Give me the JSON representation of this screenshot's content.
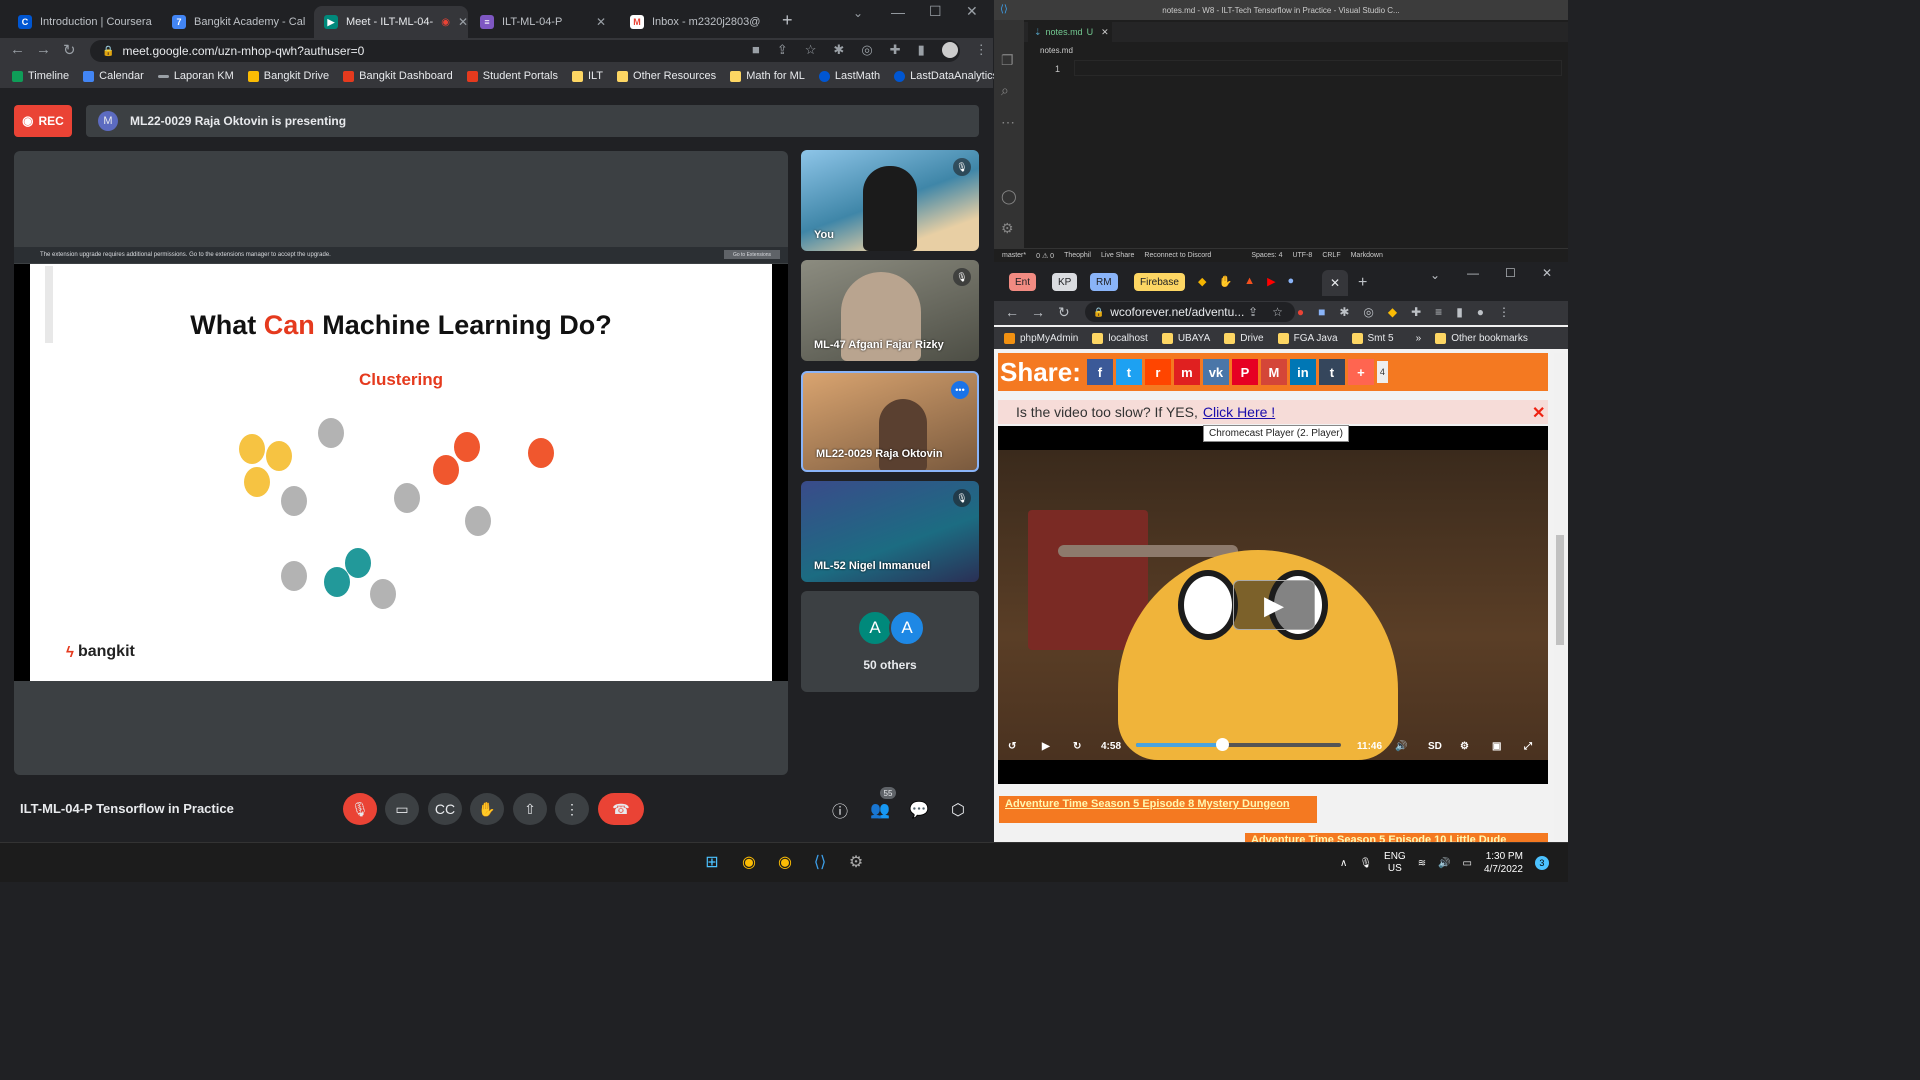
{
  "left_browser": {
    "tabs": [
      {
        "label": "Introduction | Coursera",
        "icon": "coursera-icon",
        "color": "#0056d2"
      },
      {
        "label": "Bangkit Academy - Cal",
        "icon": "calendar-icon",
        "color": "#4285f4"
      },
      {
        "label": "Meet - ILT-ML-04-",
        "icon": "meet-icon",
        "color": "#00897b"
      },
      {
        "label": "ILT-ML-04-P",
        "icon": "doc-icon",
        "color": "#7e57c2"
      },
      {
        "label": "Inbox - m2320j2803@",
        "icon": "gmail-icon",
        "color": "#ea4335"
      }
    ],
    "url": "meet.google.com/uzn-mhop-qwh?authuser=0",
    "bookmarks": [
      "Timeline",
      "Calendar",
      "Laporan KM",
      "Bangkit Drive",
      "Bangkit Dashboard",
      "Student Portals",
      "ILT",
      "Other Resources",
      "Math for ML",
      "LastMath",
      "LastDataAnalytics"
    ]
  },
  "meet": {
    "rec_label": "REC",
    "presenter_initial": "M",
    "presenting_text": "ML22-0029 Raja Oktovin is presenting",
    "extension_notice": "The extension upgrade requires additional permissions. Go to the extensions manager to accept the upgrade.",
    "extension_button": "Go to Extensions",
    "slide": {
      "title_pre": "What ",
      "title_highlight": "Can",
      "title_post": " Machine Learning Do?",
      "subtitle": "Clustering",
      "logo": "bangkit"
    },
    "participants": [
      {
        "name": "You",
        "muted": true
      },
      {
        "name": "ML-47 Afgani Fajar Rizky",
        "muted": true
      },
      {
        "name": "ML22-0029 Raja Oktovin",
        "muted": false
      },
      {
        "name": "ML-52 Nigel Immanuel",
        "muted": true
      }
    ],
    "others_avatars": [
      "A",
      "A"
    ],
    "others_label": "50 others",
    "meeting_name": "ILT-ML-04-P Tensorflow in Practice",
    "people_count": "55",
    "colors": {
      "red": "#ea4335",
      "accent_orange": "#e53a1e",
      "teal": "#22999a",
      "yellow": "#f6c342",
      "gray": "#b3b3b3"
    }
  },
  "vscode": {
    "title": "notes.md - W8 - ILT-Tech Tensorflow in Practice - Visual Studio C...",
    "tab": "notes.md",
    "tab_status": "U",
    "breadcrumb": "notes.md",
    "line_number": "1",
    "status_items": [
      "master*",
      "0 ⚠ 0",
      "Theophil",
      "Live Share",
      "Reconnect to Discord",
      "Spaces: 4",
      "UTF-8",
      "CRLF",
      "Markdown"
    ]
  },
  "right_browser": {
    "group_tabs": [
      {
        "label": "Ent",
        "color": "#f28b82"
      },
      {
        "label": "KP",
        "color": "#dadce0"
      },
      {
        "label": "RM",
        "color": "#8ab4f8"
      },
      {
        "label": "Firebase",
        "color": "#fdd663"
      }
    ],
    "url": "wcoforever.net/adventu...",
    "bookmarks": [
      "phpMyAdmin",
      "localhost",
      "UBAYA",
      "Drive",
      "FGA Java",
      "Smt 5",
      "Other bookmarks"
    ],
    "share_label": "Share:",
    "share_count": "4",
    "slow_text": "Is the video too slow? If YES,",
    "slow_link": "Click Here !",
    "tooltip": "Chromecast Player (2. Player)",
    "player": {
      "current_time": "4:58",
      "duration": "11:46",
      "quality": "SD",
      "progress": 0.42
    },
    "episodes": [
      "Adventure Time Season 5 Episode 8 Mystery Dungeon",
      "Adventure Time Season 5 Episode 10 Little Dude"
    ]
  },
  "taskbar": {
    "lang_top": "ENG",
    "lang_bottom": "US",
    "time": "1:30 PM",
    "date": "4/7/2022",
    "notif_count": "3"
  }
}
